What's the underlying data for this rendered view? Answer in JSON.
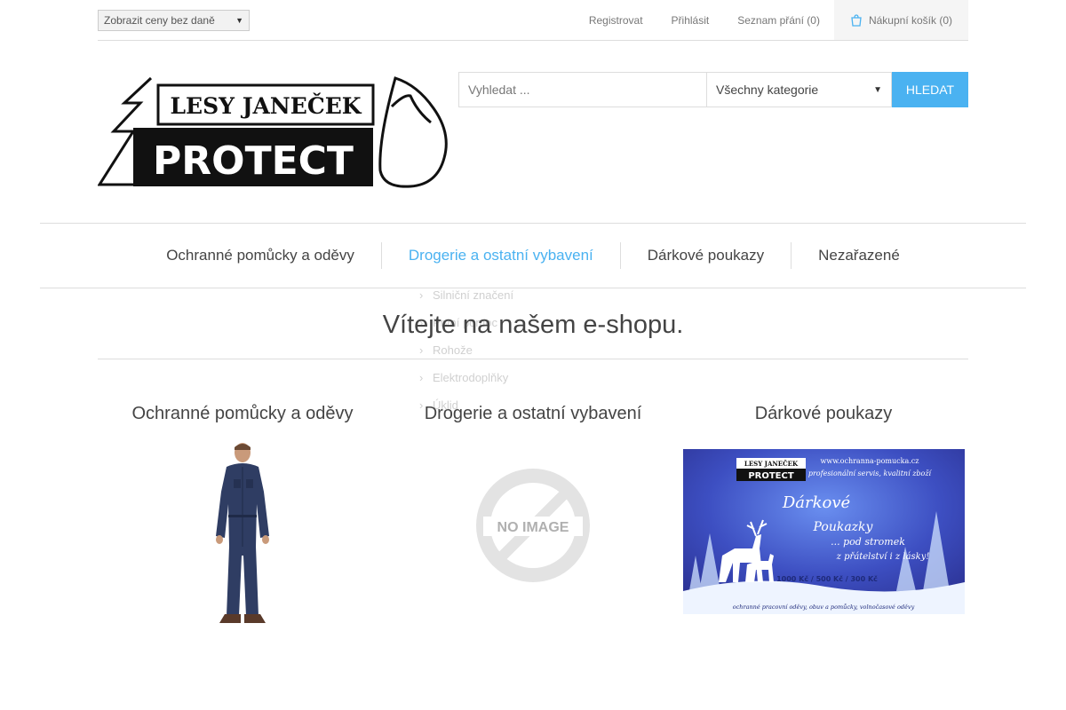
{
  "header": {
    "tax_select_value": "Zobrazit ceny bez daně",
    "links": {
      "register": "Registrovat",
      "login": "Přihlásit",
      "wishlist": "Seznam přání (0)",
      "cart": "Nákupní košík (0)"
    }
  },
  "logo": {
    "line1": "LESY JANEČEK",
    "line2": "PROTECT"
  },
  "search": {
    "placeholder": "Vyhledat ...",
    "category": "Všechny kategorie",
    "button": "HLEDAT"
  },
  "menu": {
    "items": [
      "Ochranné pomůcky a oděvy",
      "Drogerie a ostatní vybavení",
      "Dárkové poukazy",
      "Nezařazené"
    ],
    "active_index": 1,
    "submenu": [
      "Silniční značení",
      "První pomoc",
      "Rohože",
      "Elektrodoplňky",
      "Úklid"
    ]
  },
  "main": {
    "title": "Vítejte na našem e-shopu.",
    "categories": [
      {
        "name": "Ochranné pomůcky a oděvy",
        "image": "coverall-product-photo"
      },
      {
        "name": "Drogerie a ostatní vybavení",
        "image": "no-image-placeholder",
        "placeholder_text": "NO IMAGE"
      },
      {
        "name": "Dárkové poukazy",
        "image": "gift-voucher-banner",
        "banner": {
          "brand_top": "LESY JANEČEK",
          "brand_bottom": "PROTECT",
          "url": "www.ochranna-pomucka.cz",
          "tagline1": "profesionální servis, kvalitní zboží",
          "word1": "Dárkové",
          "word2": "Poukazky",
          "line3": "... pod stromek",
          "line4": "z přátelství i z lásky!",
          "prices": "1000 Kč / 500 Kč / 300 Kč",
          "footer": "ochranné pracovní oděvy, obuv a pomůcky, volnočasové oděvy"
        }
      }
    ]
  },
  "colors": {
    "accent": "#4ab2f1",
    "text": "#444444",
    "border": "#dddddd"
  }
}
